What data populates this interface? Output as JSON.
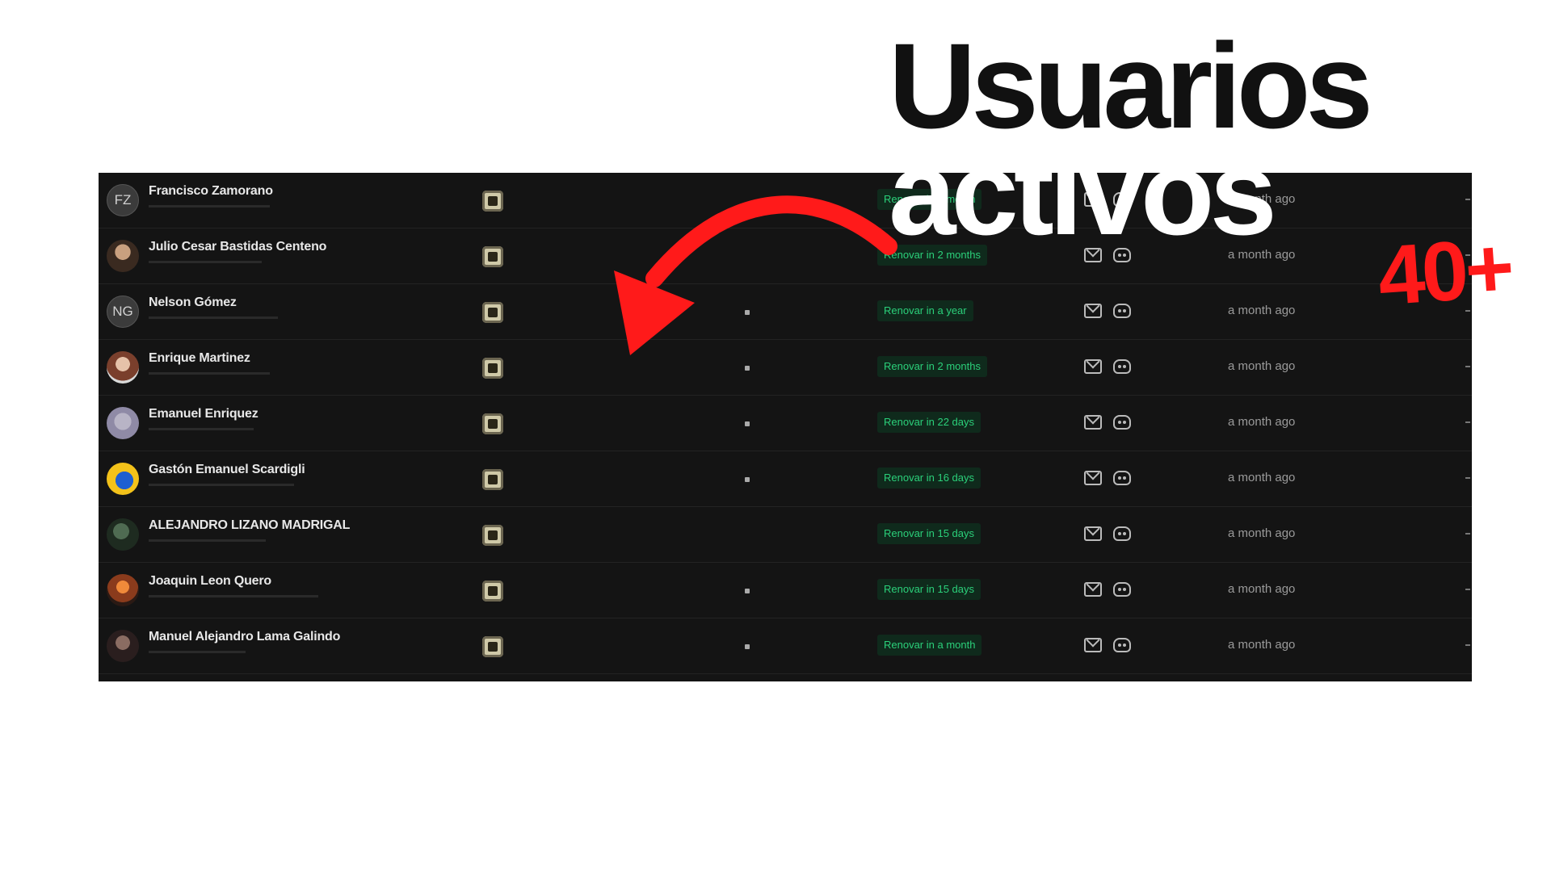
{
  "headline": {
    "line1": "Usuarios",
    "line2": "activos",
    "count": "40+"
  },
  "users": [
    {
      "name": "Francisco Zamorano",
      "avatar": "FZ",
      "status": "Renovar in a month",
      "last_seen": "a month ago"
    },
    {
      "name": "Julio Cesar Bastidas Centeno",
      "avatar": "",
      "status": "Renovar in 2 months",
      "last_seen": "a month ago"
    },
    {
      "name": "Nelson Gómez",
      "avatar": "NG",
      "status": "Renovar in a year",
      "last_seen": "a month ago"
    },
    {
      "name": "Enrique Martinez",
      "avatar": "",
      "status": "Renovar in 2 months",
      "last_seen": "a month ago"
    },
    {
      "name": "Emanuel Enriquez",
      "avatar": "",
      "status": "Renovar in 22 days",
      "last_seen": "a month ago"
    },
    {
      "name": "Gastón Emanuel Scardigli",
      "avatar": "",
      "status": "Renovar in 16 days",
      "last_seen": "a month ago"
    },
    {
      "name": "ALEJANDRO LIZANO MADRIGAL",
      "avatar": "",
      "status": "Renovar in 15 days",
      "last_seen": "a month ago"
    },
    {
      "name": "Joaquin Leon Quero",
      "avatar": "",
      "status": "Renovar in 15 days",
      "last_seen": "a month ago"
    },
    {
      "name": "Manuel Alejandro Lama Galindo",
      "avatar": "",
      "status": "Renovar in a month",
      "last_seen": "a month ago"
    }
  ],
  "colors": {
    "panel": "#141414",
    "badge_text": "#2bd07a",
    "badge_bg": "#0f2a1c",
    "arrow": "#ff1a1a",
    "headline": "#111111"
  }
}
